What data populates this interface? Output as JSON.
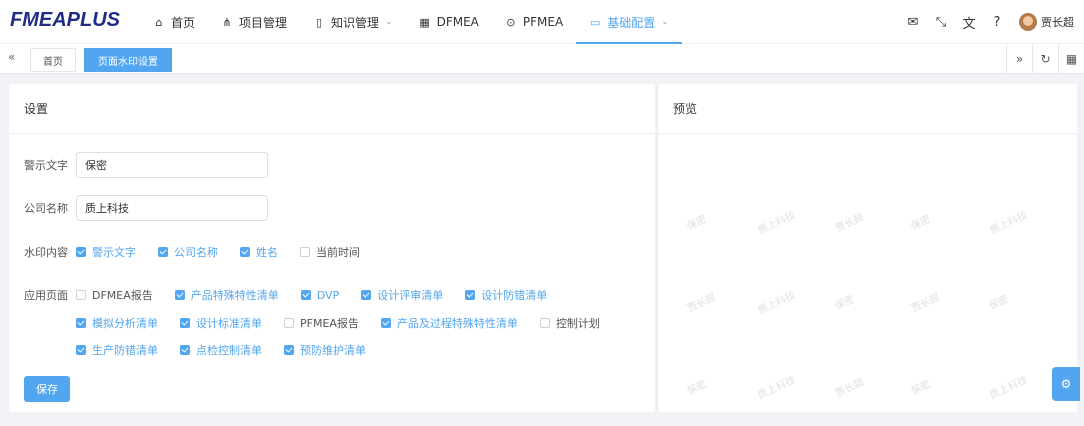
{
  "app": {
    "logo": "FMEAPLUS"
  },
  "nav": [
    {
      "icon": "home-icon",
      "glyph": "⌂",
      "label": "首页"
    },
    {
      "icon": "project-tree-icon",
      "glyph": "⋔",
      "label": "项目管理"
    },
    {
      "icon": "book-icon",
      "glyph": "▯",
      "label": "知识管理",
      "has_dropdown": true
    },
    {
      "icon": "grid-icon",
      "glyph": "▦",
      "label": "DFMEA"
    },
    {
      "icon": "target-icon",
      "glyph": "⊙",
      "label": "PFMEA"
    },
    {
      "icon": "calendar-icon",
      "glyph": "▭",
      "label": "基础配置",
      "has_dropdown": true,
      "active": true
    }
  ],
  "header_tools": {
    "user_name": "贾长超"
  },
  "tabs": [
    {
      "label": "首页",
      "active": false
    },
    {
      "label": "页面水印设置",
      "active": true
    }
  ],
  "settings": {
    "title": "设置",
    "warning_text": {
      "label": "警示文字",
      "value": "保密"
    },
    "company_name": {
      "label": "公司名称",
      "value": "质上科技"
    },
    "watermark_content": {
      "label": "水印内容",
      "options": [
        {
          "label": "警示文字",
          "checked": true
        },
        {
          "label": "公司名称",
          "checked": true
        },
        {
          "label": "姓名",
          "checked": true
        },
        {
          "label": "当前时间",
          "checked": false
        }
      ]
    },
    "apply_pages": {
      "label": "应用页面",
      "rows": [
        [
          {
            "label": "DFMEA报告",
            "checked": false
          },
          {
            "label": "产品特殊特性清单",
            "checked": true
          },
          {
            "label": "DVP",
            "checked": true
          },
          {
            "label": "设计评审清单",
            "checked": true
          },
          {
            "label": "设计防错清单",
            "checked": true
          }
        ],
        [
          {
            "label": "模拟分析清单",
            "checked": true
          },
          {
            "label": "设计标准清单",
            "checked": true
          },
          {
            "label": "PFMEA报告",
            "checked": false
          },
          {
            "label": "产品及过程特殊特性清单",
            "checked": true
          },
          {
            "label": "控制计划",
            "checked": false
          }
        ],
        [
          {
            "label": "生产防错清单",
            "checked": true
          },
          {
            "label": "点检控制清单",
            "checked": true
          },
          {
            "label": "预防维护清单",
            "checked": true
          }
        ]
      ]
    },
    "save_label": "保存"
  },
  "preview": {
    "title": "预览",
    "watermark_rows": [
      [
        "保密",
        "质上科技",
        "贾长超",
        "保密",
        "质上科技"
      ],
      [
        "贾长超",
        "质上科技",
        "保密",
        "贾长超",
        "保密"
      ],
      [
        "保密",
        "质上科技",
        "贾长超",
        "保密",
        "质上科技"
      ]
    ]
  }
}
